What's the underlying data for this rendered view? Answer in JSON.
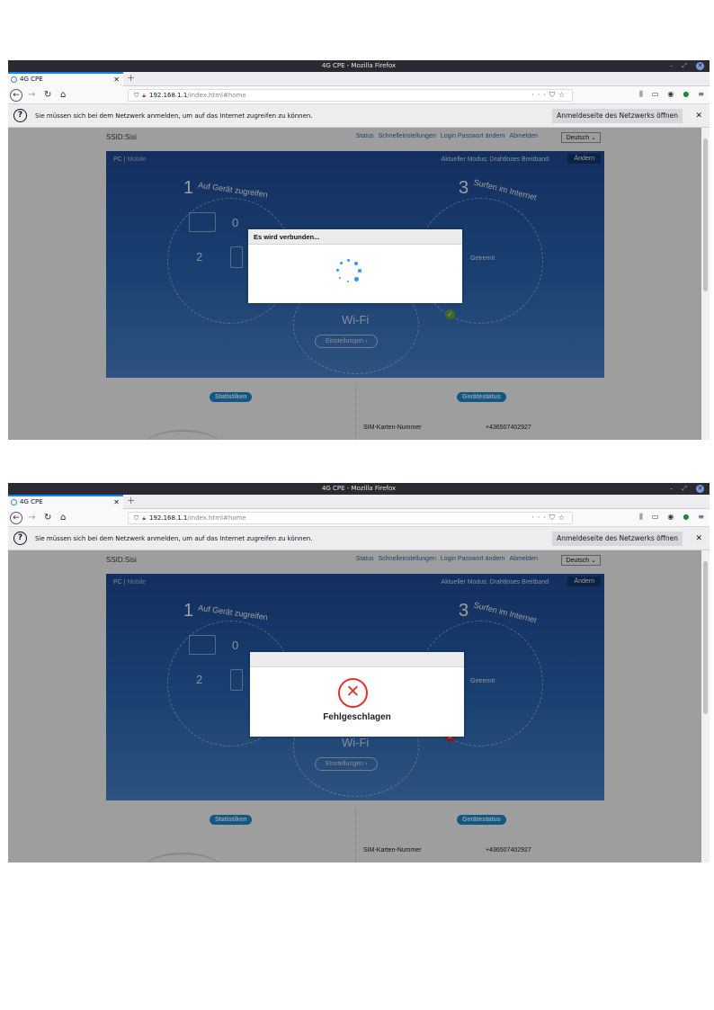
{
  "browser": {
    "window_title": "4G CPE - Mozilla Firefox",
    "tab_title": "4G CPE",
    "url_host": "192.168.1.1",
    "url_path": "/index.html#home"
  },
  "notification": {
    "message": "Sie müssen sich bei dem Netzwerk anmelden, um auf das Internet zugreifen zu können.",
    "button_label": "Anmeldeseite des Netzwerks öffnen"
  },
  "router": {
    "ssid": "SSID:Sisi",
    "nav": [
      "Status",
      "Schnelleinstellungen",
      "Login Passwort ändern",
      "Abmelden"
    ],
    "language": "Deutsch",
    "view_pc": "PC",
    "view_sep": " | ",
    "view_mobile": "Mobile",
    "mode_info": "Aktueller Modus: Drahtloses Breitband",
    "change_button": "Ändern",
    "step1_num": "1",
    "step1_label": "Auf Gerät zugreifen",
    "step3_num": "3",
    "step3_label": "Surfen im Internet",
    "device_count_pc": "0",
    "device_count_mobile": "2",
    "internet_status": "Getrennt",
    "wifi_label": "Wi-Fi",
    "wifi_settings_button": "Einstellungen",
    "stats_label": "Statistiken",
    "device_status_label": "Gerätestatus",
    "sim_label": "SIM-Karten-Nummer",
    "sim_value": "+436507402927"
  },
  "dialogs": {
    "connecting_title": "Es wird verbunden...",
    "failed_text": "Fehlgeschlagen"
  }
}
